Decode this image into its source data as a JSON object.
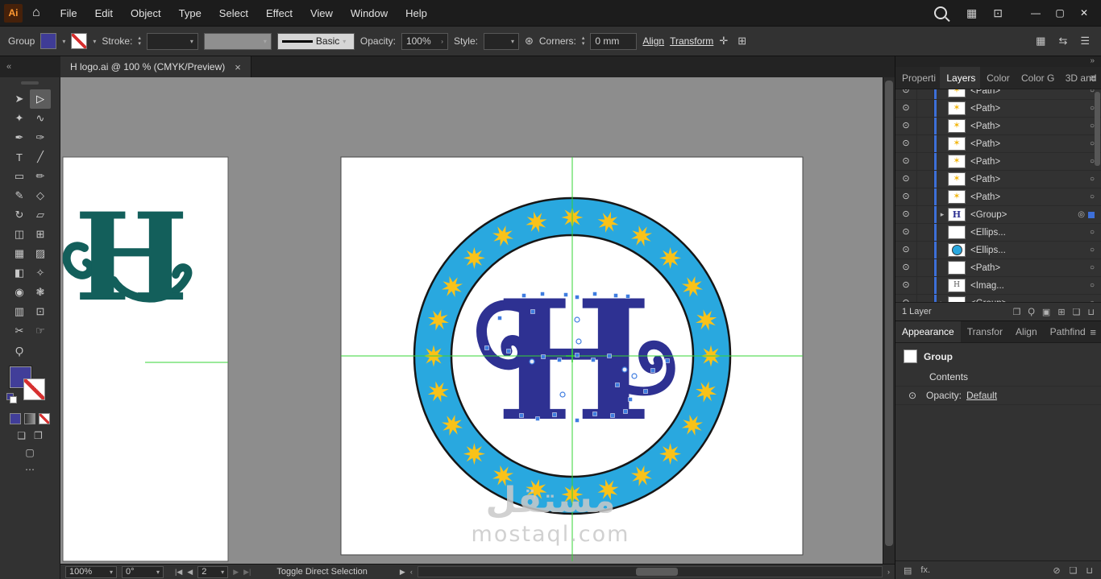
{
  "window": {
    "app_badge": "Ai",
    "controls": [
      {
        "name": "minimize-button",
        "glyph": "—"
      },
      {
        "name": "maximize-button",
        "glyph": "▢"
      },
      {
        "name": "close-button",
        "glyph": "✕"
      }
    ],
    "menubar_icons": [
      {
        "name": "organize-apps-icon",
        "glyph": "▦"
      },
      {
        "name": "screen-layout-icon",
        "glyph": "⊡"
      }
    ]
  },
  "menu_bar": {
    "items": [
      "File",
      "Edit",
      "Object",
      "Type",
      "Select",
      "Effect",
      "View",
      "Window",
      "Help"
    ]
  },
  "control_bar": {
    "context_label": "Group",
    "fill_color": "#3f3c96",
    "stroke_label": "Stroke:",
    "stroke_style_value": "Basic",
    "opacity_label": "Opacity:",
    "opacity_value": "100%",
    "style_label": "Style:",
    "corners_label": "Corners:",
    "corners_value": "0 mm",
    "align_label": "Align",
    "transform_label": "Transform",
    "snap_icons": [
      {
        "name": "align-to-glyph-icon",
        "glyph": "✛"
      },
      {
        "name": "snap-options-icon",
        "glyph": "⊞"
      }
    ],
    "right_icons": [
      {
        "name": "document-grid-icon",
        "glyph": "▦"
      },
      {
        "name": "arrange-documents-icon",
        "glyph": "⇆"
      },
      {
        "name": "workspace-switcher-icon",
        "glyph": "☰"
      }
    ]
  },
  "document_tab": {
    "title": "H logo.ai @ 100 % (CMYK/Preview)"
  },
  "toolbar": {
    "fill_color": "#413e99",
    "tools": [
      {
        "name": "selection-tool",
        "glyph": "➤",
        "active": false
      },
      {
        "name": "direct-selection-tool",
        "glyph": "▷",
        "active": true
      },
      {
        "name": "magic-wand-tool",
        "glyph": "✦",
        "active": false
      },
      {
        "name": "lasso-tool",
        "glyph": "∿",
        "active": false
      },
      {
        "name": "pen-tool",
        "glyph": "✒",
        "active": false
      },
      {
        "name": "curvature-tool",
        "glyph": "✑",
        "active": false
      },
      {
        "name": "type-tool",
        "glyph": "T",
        "active": false
      },
      {
        "name": "line-segment-tool",
        "glyph": "╱",
        "active": false
      },
      {
        "name": "rectangle-tool",
        "glyph": "▭",
        "active": false
      },
      {
        "name": "paintbrush-tool",
        "glyph": "✏",
        "active": false
      },
      {
        "name": "shaper-tool",
        "glyph": "✎",
        "active": false
      },
      {
        "name": "eraser-tool",
        "glyph": "◇",
        "active": false
      },
      {
        "name": "rotate-tool",
        "glyph": "↻",
        "active": false
      },
      {
        "name": "scale-tool",
        "glyph": "▱",
        "active": false
      },
      {
        "name": "width-tool",
        "glyph": "◫",
        "active": false
      },
      {
        "name": "free-transform-tool",
        "glyph": "⊞",
        "active": false
      },
      {
        "name": "perspective-grid-tool",
        "glyph": "▦",
        "active": false
      },
      {
        "name": "mesh-tool",
        "glyph": "▨",
        "active": false
      },
      {
        "name": "gradient-tool",
        "glyph": "◧",
        "active": false
      },
      {
        "name": "eyedropper-tool",
        "glyph": "✧",
        "active": false
      },
      {
        "name": "blend-tool",
        "glyph": "◉",
        "active": false
      },
      {
        "name": "symbol-sprayer-tool",
        "glyph": "❃",
        "active": false
      },
      {
        "name": "column-graph-tool",
        "glyph": "▥",
        "active": false
      },
      {
        "name": "artboard-tool",
        "glyph": "⊡",
        "active": false
      },
      {
        "name": "slice-tool",
        "glyph": "✂",
        "active": false
      },
      {
        "name": "hand-tool",
        "glyph": "☞",
        "active": false
      },
      {
        "name": "zoom-tool",
        "glyph": "Ϙ",
        "active": false
      }
    ]
  },
  "canvas": {
    "pasteboard_color": "#8d8d8d",
    "guide_color": "#35d435",
    "watermark": {
      "line1": "مستقل",
      "line2": "mostaql.com"
    },
    "logo": {
      "letter": "H",
      "letter_color": "#2e3192",
      "ring_fill": "#29a8df",
      "ring_stroke": "#161616",
      "star_color": "#f9c219",
      "star_count": 24,
      "anchor_color": "#3f7de0"
    },
    "left_artboard": {
      "letter": "H",
      "letter_color": "#135f5b"
    }
  },
  "panels": {
    "dock_tabs": [
      {
        "label": "Properti",
        "active": false
      },
      {
        "label": "Layers",
        "active": true
      },
      {
        "label": "Color",
        "active": false
      },
      {
        "label": "Color G",
        "active": false
      },
      {
        "label": "3D and",
        "active": false
      }
    ],
    "layers": {
      "rows": [
        {
          "label": "<Path>",
          "thumb": "star",
          "clipped": true,
          "expand": false,
          "selected": false
        },
        {
          "label": "<Path>",
          "thumb": "star",
          "clipped": false,
          "expand": false,
          "selected": false
        },
        {
          "label": "<Path>",
          "thumb": "star",
          "clipped": false,
          "expand": false,
          "selected": false
        },
        {
          "label": "<Path>",
          "thumb": "star",
          "clipped": false,
          "expand": false,
          "selected": false
        },
        {
          "label": "<Path>",
          "thumb": "star",
          "clipped": false,
          "expand": false,
          "selected": false
        },
        {
          "label": "<Path>",
          "thumb": "star",
          "clipped": false,
          "expand": false,
          "selected": false
        },
        {
          "label": "<Path>",
          "thumb": "star",
          "clipped": false,
          "expand": false,
          "selected": false
        },
        {
          "label": "<Group>",
          "thumb": "letter",
          "clipped": false,
          "expand": true,
          "selected": true
        },
        {
          "label": "<Ellips...",
          "thumb": "blank",
          "clipped": false,
          "expand": false,
          "selected": false
        },
        {
          "label": "<Ellips...",
          "thumb": "circle",
          "clipped": false,
          "expand": false,
          "selected": false
        },
        {
          "label": "<Path>",
          "thumb": "blank",
          "clipped": false,
          "expand": false,
          "selected": false
        },
        {
          "label": "<Imag...",
          "thumb": "letter-small",
          "clipped": false,
          "expand": false,
          "selected": false
        },
        {
          "label": "<Group>",
          "thumb": "blank",
          "clipped": false,
          "expand": true,
          "selected": false
        }
      ],
      "footer_label": "1 Layer",
      "footer_icons": [
        {
          "name": "collect-for-export-icon",
          "glyph": "❐"
        },
        {
          "name": "locate-object-icon",
          "glyph": "Ϙ"
        },
        {
          "name": "make-clipping-mask-icon",
          "glyph": "▣"
        },
        {
          "name": "new-sublayer-icon",
          "glyph": "⊞"
        },
        {
          "name": "new-layer-icon",
          "glyph": "❏"
        },
        {
          "name": "delete-selection-icon",
          "glyph": "⊔"
        }
      ]
    },
    "appearance": {
      "tabs": [
        {
          "label": "Appearance",
          "active": true
        },
        {
          "label": "Transfor",
          "active": false
        },
        {
          "label": "Align",
          "active": false
        },
        {
          "label": "Pathfind",
          "active": false
        }
      ],
      "item_label": "Group",
      "contents_label": "Contents",
      "opacity_label": "Opacity:",
      "opacity_value": "Default",
      "footer_left": [
        {
          "name": "add-new-stroke-icon",
          "glyph": "▤"
        },
        {
          "name": "add-new-effect-icon",
          "glyph": "fx."
        }
      ],
      "footer_right": [
        {
          "name": "clear-appearance-icon",
          "glyph": "⊘"
        },
        {
          "name": "duplicate-selected-item-icon",
          "glyph": "❏"
        },
        {
          "name": "delete-selected-item-icon",
          "glyph": "⊔"
        }
      ]
    }
  },
  "status_bar": {
    "zoom_value": "100%",
    "rotation_value": "0°",
    "artboard_value": "2",
    "status_text": "Toggle Direct Selection"
  },
  "icons": {
    "home": "⌂",
    "chevron_down": "▾",
    "chevron_right": "▸",
    "panel_menu": "≡",
    "collapse_dock": "«",
    "expand_dock": "»",
    "eye": "⊙",
    "target": "○",
    "target_selected": "◎",
    "arrow_left": "◀",
    "arrow_right": "▶",
    "first_artboard": "|◀",
    "last_artboard": "▶|",
    "scroll_left": "‹",
    "scroll_right": "›",
    "more": "⋯",
    "globe": "⊛",
    "close_tab": "×",
    "stepper_up": "▴",
    "stepper_down": "▾",
    "star_thumb": "✶",
    "opacity_chevron": "›"
  }
}
